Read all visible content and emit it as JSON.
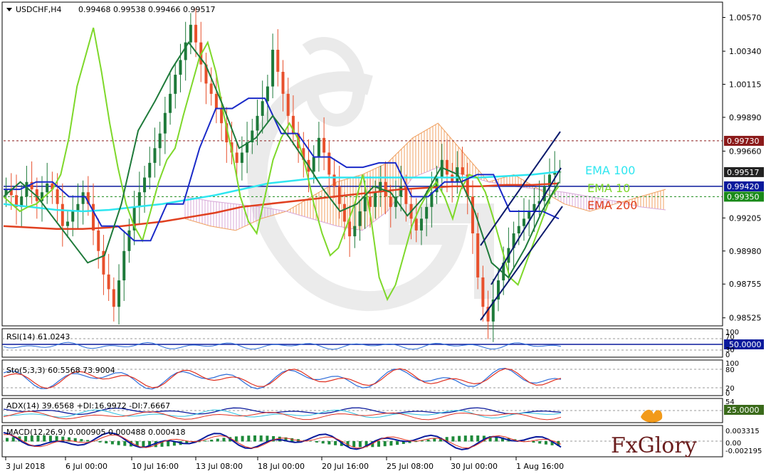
{
  "header": {
    "symbol": "USDCHF,H4",
    "ohlc": "0.99468 0.99538 0.99466 0.99517"
  },
  "price_axis": {
    "ticks": [
      "1.00570",
      "1.00340",
      "1.00115",
      "0.99890",
      "0.99660",
      "0.99205",
      "0.98980",
      "0.98755",
      "0.98525"
    ],
    "tags": [
      {
        "label": "0.99730",
        "value": 0.9973,
        "color": "#8b1a1a"
      },
      {
        "label": "0.99517",
        "value": 0.99517,
        "color": "#222222"
      },
      {
        "label": "0.99420",
        "value": 0.9942,
        "color": "#0a1a9c"
      },
      {
        "label": "0.99350",
        "value": 0.9935,
        "color": "#1a8a1a"
      }
    ]
  },
  "time_axis": [
    "3 Jul 2018",
    "6 Jul 00:00",
    "10 Jul 16:00",
    "13 Jul 08:00",
    "18 Jul 00:00",
    "20 Jul 16:00",
    "25 Jul 08:00",
    "30 Jul 00:00",
    "1 Aug 16:00"
  ],
  "ema_labels": [
    {
      "text": "EMA 100",
      "color": "#2ee6f0"
    },
    {
      "text": "EMA 10",
      "color": "#7ed82a"
    },
    {
      "text": "EMA 200",
      "color": "#e04020"
    }
  ],
  "indicators": {
    "rsi": {
      "label": "RSI(14) 61.0243",
      "tag": "50.0000",
      "ticks": [
        "100",
        "70",
        "30",
        "0"
      ]
    },
    "sto": {
      "label": "Sto(5,3,3) 60.5568 73.9004",
      "ticks": [
        "100",
        "80",
        "20",
        "0"
      ]
    },
    "adx": {
      "label": "ADX(14) 39.6568 +DI:16.9972 -DI:7.6667",
      "tag": "25.0000",
      "ticks": [
        "54"
      ]
    },
    "macd": {
      "label": "MACD(12,26,9) 0.000905 0.000488 0.000418",
      "ticks": [
        "0.003315",
        "0.00",
        "-0.002195"
      ]
    }
  },
  "logo": {
    "text": "FxGlory",
    "color": "#6b1e1e",
    "accent": "#f29a1a"
  },
  "colors": {
    "bull_candle": "#1e7a3a",
    "bear_candle": "#e8502c",
    "ema10": "#7ed82a",
    "ema100": "#2ee6f0",
    "ema200": "#e04020",
    "kijun": "#1a2ac8",
    "tenkan": "#1e7a3a",
    "cloud_bull": "#f0a060",
    "cloud_bear": "#d8a8d8",
    "channel": "#0a1a6c"
  },
  "chart_data": {
    "type": "candlestick",
    "title": "USDCHF,H4",
    "ylim": [
      0.9848,
      1.0065
    ],
    "x_ticks": [
      "3 Jul 2018",
      "6 Jul 00:00",
      "10 Jul 16:00",
      "13 Jul 08:00",
      "18 Jul 00:00",
      "20 Jul 16:00",
      "25 Jul 08:00",
      "30 Jul 00:00",
      "1 Aug 16:00"
    ],
    "y_ticks": [
      1.0057,
      1.0034,
      1.00115,
      0.9989,
      0.9966,
      0.99205,
      0.9898,
      0.98755,
      0.98525
    ],
    "close": [
      0.994,
      0.9936,
      0.9928,
      0.9935,
      0.9945,
      0.994,
      0.9932,
      0.9938,
      0.9944,
      0.994,
      0.993,
      0.9915,
      0.9918,
      0.9925,
      0.993,
      0.9938,
      0.993,
      0.9912,
      0.9898,
      0.9882,
      0.9872,
      0.986,
      0.9878,
      0.9898,
      0.9912,
      0.9928,
      0.9938,
      0.9948,
      0.9958,
      0.9968,
      0.9978,
      0.9992,
      1.0005,
      1.0018,
      1.0028,
      1.004,
      1.0052,
      1.004,
      1.0025,
      1.0012,
      1.0005,
      0.9995,
      0.9985,
      0.9972,
      0.9965,
      0.9958,
      0.9965,
      0.9972,
      0.998,
      0.999,
      1.0,
      1.001,
      1.0035,
      1.002,
      1.0005,
      0.999,
      0.9978,
      0.9968,
      0.996,
      0.9952,
      0.9962,
      0.9975,
      0.9965,
      0.995,
      0.9942,
      0.993,
      0.9918,
      0.9908,
      0.9915,
      0.9925,
      0.9935,
      0.9928,
      0.9938,
      0.9945,
      0.9935,
      0.9928,
      0.9935,
      0.9942,
      0.993,
      0.992,
      0.9912,
      0.992,
      0.9928,
      0.9938,
      0.9948,
      0.996,
      0.995,
      0.9945,
      0.9955,
      0.995,
      0.9935,
      0.991,
      0.988,
      0.986,
      0.985,
      0.9865,
      0.9878,
      0.989,
      0.99,
      0.991,
      0.9915,
      0.992,
      0.9925,
      0.993,
      0.9932,
      0.9942,
      0.995,
      0.9952,
      0.9952
    ],
    "ema10": [
      0.9935,
      0.993,
      0.9925,
      0.9928,
      0.993,
      0.9935,
      0.994,
      0.995,
      0.9975,
      1.001,
      1.003,
      1.005,
      1.002,
      0.9985,
      0.9955,
      0.993,
      0.9915,
      0.9905,
      0.9925,
      0.9945,
      0.996,
      0.9968,
      0.999,
      1.001,
      1.003,
      1.004,
      1.002,
      0.999,
      0.9965,
      0.9935,
      0.9918,
      0.991,
      0.9935,
      0.996,
      0.9975,
      0.9985,
      0.9975,
      0.9955,
      0.993,
      0.991,
      0.9895,
      0.99,
      0.9915,
      0.993,
      0.995,
      0.992,
      0.988,
      0.9865,
      0.9875,
      0.9895,
      0.9915,
      0.9928,
      0.9938,
      0.9945,
      0.9935,
      0.992,
      0.994,
      0.995,
      0.9948,
      0.9938,
      0.992,
      0.99,
      0.988,
      0.9875,
      0.989,
      0.9905,
      0.992,
      0.9935,
      0.9942
    ],
    "ema100": [
      0.993,
      0.9928,
      0.9926,
      0.9925,
      0.9926,
      0.9928,
      0.993,
      0.9933,
      0.9936,
      0.994,
      0.9944,
      0.9946,
      0.9948,
      0.9948,
      0.9948,
      0.9948,
      0.9948,
      0.9948,
      0.9948,
      0.9949,
      0.995,
      0.9952
    ],
    "ema200": [
      0.9915,
      0.9914,
      0.9913,
      0.9913,
      0.9914,
      0.9916,
      0.9918,
      0.9921,
      0.9924,
      0.9928,
      0.993,
      0.9932,
      0.9934,
      0.9936,
      0.9938,
      0.994,
      0.9941,
      0.9942,
      0.9942,
      0.9943,
      0.9943,
      0.9944
    ],
    "levels": [
      0.9973,
      0.9942,
      0.9935
    ]
  }
}
